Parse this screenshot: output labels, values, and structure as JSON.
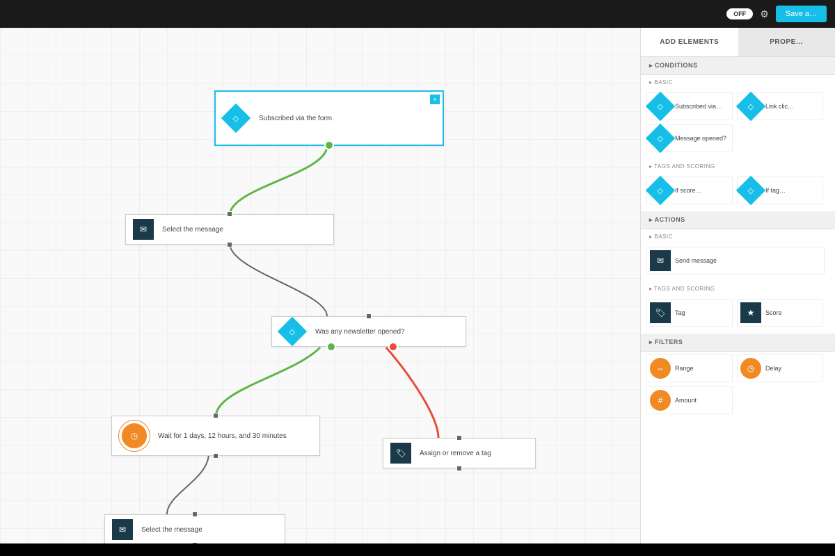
{
  "topbar": {
    "toggle": "OFF",
    "save": "Save a…"
  },
  "panel": {
    "tabs": {
      "add": "ADD ELEMENTS",
      "props": "PROPE…"
    },
    "conditions": {
      "header": "▸ CONDITIONS",
      "basic": "▸ BASIC",
      "subscribed": "Subscribed via…",
      "link": "Link clic…",
      "opened": "Message opened?",
      "tags_scoring": "▸ TAGS AND SCORING",
      "ifscore": "If score…",
      "iftag": "If tag…"
    },
    "actions": {
      "header": "▸ ACTIONS",
      "basic": "▸ BASIC",
      "send": "Send message",
      "tags_scoring": "▸ TAGS AND SCORING",
      "tag": "Tag",
      "score": "Score"
    },
    "filters": {
      "header": "▸ FILTERS",
      "range": "Range",
      "delay": "Delay",
      "amount": "Amount"
    }
  },
  "nodes": {
    "n1": "Subscribed via the form",
    "n2": "Select the message",
    "n3": "Was any newsletter opened?",
    "n4": "Wait for 1 days, 12 hours, and 30 minutes",
    "n5": "Assign or remove a tag",
    "n6": "Select the message"
  }
}
